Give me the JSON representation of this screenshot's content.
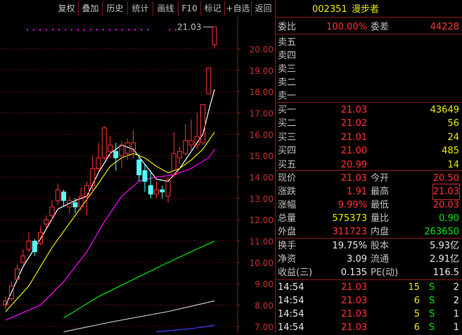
{
  "toolbar": {
    "items": [
      "复权",
      "叠加",
      "历史",
      "统计",
      "画线",
      "F10",
      "标记",
      "+自选",
      "返回"
    ]
  },
  "colors": {
    "up": "#ff3232",
    "down": "#54ffff",
    "ma5": "#ffffff",
    "ma10": "#e8e800",
    "ma20": "#ff00ff",
    "ma60": "#00e600",
    "ma120": "#c0c0c0",
    "ma250": "#3c3cff",
    "grid": "#8b1a1a"
  },
  "chart_data": {
    "type": "candlestick",
    "ylim": [
      6.7,
      21.5
    ],
    "y_ticks": [
      "20.00",
      "19.00",
      "18.00",
      "17.00",
      "16.00",
      "15.00",
      "14.00",
      "13.00",
      "12.00",
      "11.00",
      "10.00",
      "9.00",
      "8.00",
      "7.00"
    ],
    "y_tick_values": [
      20,
      19,
      18,
      17,
      16,
      15,
      14,
      13,
      12,
      11,
      10,
      9,
      8,
      7
    ],
    "annotation": "21.03",
    "candles": [
      {
        "o": 8.0,
        "c": 8.2,
        "h": 8.4,
        "l": 7.8
      },
      {
        "o": 8.3,
        "c": 8.9,
        "h": 9.1,
        "l": 8.2
      },
      {
        "o": 9.2,
        "c": 9.7,
        "h": 9.9,
        "l": 9.1
      },
      {
        "o": 10.0,
        "c": 10.3,
        "h": 10.6,
        "l": 9.9
      },
      {
        "o": 10.6,
        "c": 11.0,
        "h": 11.4,
        "l": 10.5
      },
      {
        "o": 11.0,
        "c": 10.5,
        "h": 11.1,
        "l": 10.3
      },
      {
        "o": 10.9,
        "c": 11.4,
        "h": 11.7,
        "l": 10.8
      },
      {
        "o": 11.8,
        "c": 12.0,
        "h": 12.2,
        "l": 11.6
      },
      {
        "o": 12.2,
        "c": 12.6,
        "h": 12.9,
        "l": 12.0
      },
      {
        "o": 12.9,
        "c": 13.4,
        "h": 13.7,
        "l": 12.7
      },
      {
        "o": 13.3,
        "c": 12.9,
        "h": 13.4,
        "l": 12.6
      },
      {
        "o": 12.6,
        "c": 12.9,
        "h": 13.1,
        "l": 12.3
      },
      {
        "o": 12.8,
        "c": 12.6,
        "h": 13.0,
        "l": 12.3
      },
      {
        "o": 12.6,
        "c": 13.1,
        "h": 13.5,
        "l": 12.4
      },
      {
        "o": 13.1,
        "c": 13.6,
        "h": 13.8,
        "l": 12.2
      },
      {
        "o": 13.6,
        "c": 14.4,
        "h": 15.0,
        "l": 13.3
      },
      {
        "o": 14.4,
        "c": 14.9,
        "h": 15.6,
        "l": 14.2
      },
      {
        "o": 14.9,
        "c": 16.3,
        "h": 16.4,
        "l": 14.8
      },
      {
        "o": 15.2,
        "c": 15.5,
        "h": 15.9,
        "l": 14.9
      },
      {
        "o": 15.2,
        "c": 14.9,
        "h": 15.6,
        "l": 14.3
      },
      {
        "o": 15.0,
        "c": 15.5,
        "h": 15.7,
        "l": 14.4
      },
      {
        "o": 15.1,
        "c": 15.6,
        "h": 15.8,
        "l": 14.8
      },
      {
        "o": 15.2,
        "c": 15.6,
        "h": 16.2,
        "l": 14.9
      },
      {
        "o": 14.8,
        "c": 14.1,
        "h": 15.1,
        "l": 13.8
      },
      {
        "o": 14.3,
        "c": 13.8,
        "h": 14.6,
        "l": 13.3
      },
      {
        "o": 13.6,
        "c": 13.2,
        "h": 14.3,
        "l": 13.0
      },
      {
        "o": 13.2,
        "c": 13.4,
        "h": 13.8,
        "l": 13.0
      },
      {
        "o": 13.4,
        "c": 13.3,
        "h": 13.6,
        "l": 13.0
      },
      {
        "o": 13.1,
        "c": 13.9,
        "h": 14.0,
        "l": 12.8
      },
      {
        "o": 14.1,
        "c": 15.1,
        "h": 16.1,
        "l": 14.0
      },
      {
        "o": 14.9,
        "c": 15.2,
        "h": 15.4,
        "l": 14.6
      },
      {
        "o": 15.1,
        "c": 15.7,
        "h": 16.5,
        "l": 15.0
      },
      {
        "o": 15.5,
        "c": 15.7,
        "h": 16.7,
        "l": 15.2
      },
      {
        "o": 15.5,
        "c": 15.9,
        "h": 17.0,
        "l": 15.3
      },
      {
        "o": 15.6,
        "c": 17.4,
        "h": 17.4,
        "l": 15.5
      },
      {
        "o": 17.9,
        "c": 19.1,
        "h": 19.1,
        "l": 17.9
      },
      {
        "o": 20.2,
        "c": 21.03,
        "h": 21.03,
        "l": 20.03
      }
    ],
    "ma_series": [
      {
        "key": "ma5",
        "values": [
          [
            0,
            8.0
          ],
          [
            3,
            9.8
          ],
          [
            6,
            11.1
          ],
          [
            9,
            12.5
          ],
          [
            12,
            12.9
          ],
          [
            14,
            13.1
          ],
          [
            16,
            14.2
          ],
          [
            18,
            15.1
          ],
          [
            20,
            15.5
          ],
          [
            22,
            15.3
          ],
          [
            24,
            14.6
          ],
          [
            26,
            13.9
          ],
          [
            28,
            13.8
          ],
          [
            30,
            14.4
          ],
          [
            32,
            15.2
          ],
          [
            34,
            16.0
          ],
          [
            35,
            17.1
          ],
          [
            36,
            18.1
          ]
        ]
      },
      {
        "key": "ma10",
        "values": [
          [
            0,
            7.7
          ],
          [
            4,
            8.9
          ],
          [
            8,
            10.7
          ],
          [
            12,
            12.2
          ],
          [
            16,
            13.7
          ],
          [
            18,
            14.5
          ],
          [
            20,
            14.9
          ],
          [
            22,
            15.1
          ],
          [
            24,
            14.9
          ],
          [
            26,
            14.5
          ],
          [
            28,
            14.2
          ],
          [
            30,
            14.4
          ],
          [
            32,
            14.8
          ],
          [
            34,
            15.3
          ],
          [
            36,
            16.1
          ]
        ]
      },
      {
        "key": "ma20",
        "values": [
          [
            0,
            7.3
          ],
          [
            6,
            8.0
          ],
          [
            10,
            9.1
          ],
          [
            14,
            10.5
          ],
          [
            17,
            11.9
          ],
          [
            20,
            13.1
          ],
          [
            23,
            13.8
          ],
          [
            26,
            14.0
          ],
          [
            29,
            14.1
          ],
          [
            32,
            14.4
          ],
          [
            35,
            14.9
          ],
          [
            36,
            15.3
          ]
        ]
      },
      {
        "key": "ma60",
        "values": [
          [
            10,
            7.4
          ],
          [
            16,
            8.4
          ],
          [
            22,
            9.2
          ],
          [
            28,
            10.0
          ],
          [
            32,
            10.5
          ],
          [
            36,
            11.0
          ]
        ]
      },
      {
        "key": "ma120",
        "values": [
          [
            10,
            6.75
          ],
          [
            18,
            7.2
          ],
          [
            28,
            7.7
          ],
          [
            36,
            8.2
          ]
        ]
      },
      {
        "key": "ma250",
        "values": [
          [
            26,
            6.75
          ],
          [
            32,
            6.9
          ],
          [
            36,
            7.05
          ]
        ]
      }
    ]
  },
  "quote": {
    "code": "002351",
    "name": "漫步者",
    "weibi_label": "委比",
    "weibi_value": "100.00%",
    "weicha_label": "委差",
    "weicha_value": "44228",
    "sell": [
      {
        "label": "卖五"
      },
      {
        "label": "卖四"
      },
      {
        "label": "卖三"
      },
      {
        "label": "卖二"
      },
      {
        "label": "卖一"
      }
    ],
    "buy": [
      {
        "label": "买一",
        "price": "21.03",
        "vol": "43649"
      },
      {
        "label": "买二",
        "price": "21.02",
        "vol": "56"
      },
      {
        "label": "买三",
        "price": "21.01",
        "vol": "24"
      },
      {
        "label": "买四",
        "price": "21.00",
        "vol": "485"
      },
      {
        "label": "买五",
        "price": "20.99",
        "vol": "14"
      }
    ],
    "stats": [
      {
        "l1": "现价",
        "v1": "21.03",
        "l2": "今开",
        "v2": "20.50",
        "c1": "red",
        "c2": "red",
        "box2": false
      },
      {
        "l1": "涨跌",
        "v1": "1.91",
        "l2": "最高",
        "v2": "21.03",
        "c1": "red",
        "c2": "red",
        "box2": true
      },
      {
        "l1": "涨幅",
        "v1": "9.99%",
        "l2": "最低",
        "v2": "20.03",
        "c1": "red",
        "c2": "red",
        "box2": false
      },
      {
        "l1": "总量",
        "v1": "575373",
        "l2": "量比",
        "v2": "0.90",
        "c1": "yel",
        "c2": "grn",
        "box2": false
      },
      {
        "l1": "外盘",
        "v1": "311723",
        "l2": "内盘",
        "v2": "263650",
        "c1": "red",
        "c2": "grn",
        "box2": false
      }
    ],
    "fundamentals": [
      {
        "l1": "换手",
        "v1": "19.75%",
        "l2": "股本",
        "v2": "5.93亿"
      },
      {
        "l1": "净资",
        "v1": "3.09",
        "l2": "流通",
        "v2": "2.91亿"
      },
      {
        "l1": "收益(三)",
        "v1": "0.135",
        "l2": "PE(动)",
        "v2": "116.5"
      }
    ],
    "ticks": [
      {
        "time": "14:54",
        "price": "21.03",
        "vol": "15",
        "side": "S",
        "num": "2"
      },
      {
        "time": "14:54",
        "price": "21.03",
        "vol": "6",
        "side": "S",
        "num": "2"
      },
      {
        "time": "14:54",
        "price": "21.03",
        "vol": "5",
        "side": "S",
        "num": "1"
      },
      {
        "time": "14:54",
        "price": "21.03",
        "vol": "6",
        "side": "S",
        "num": "1"
      }
    ]
  }
}
